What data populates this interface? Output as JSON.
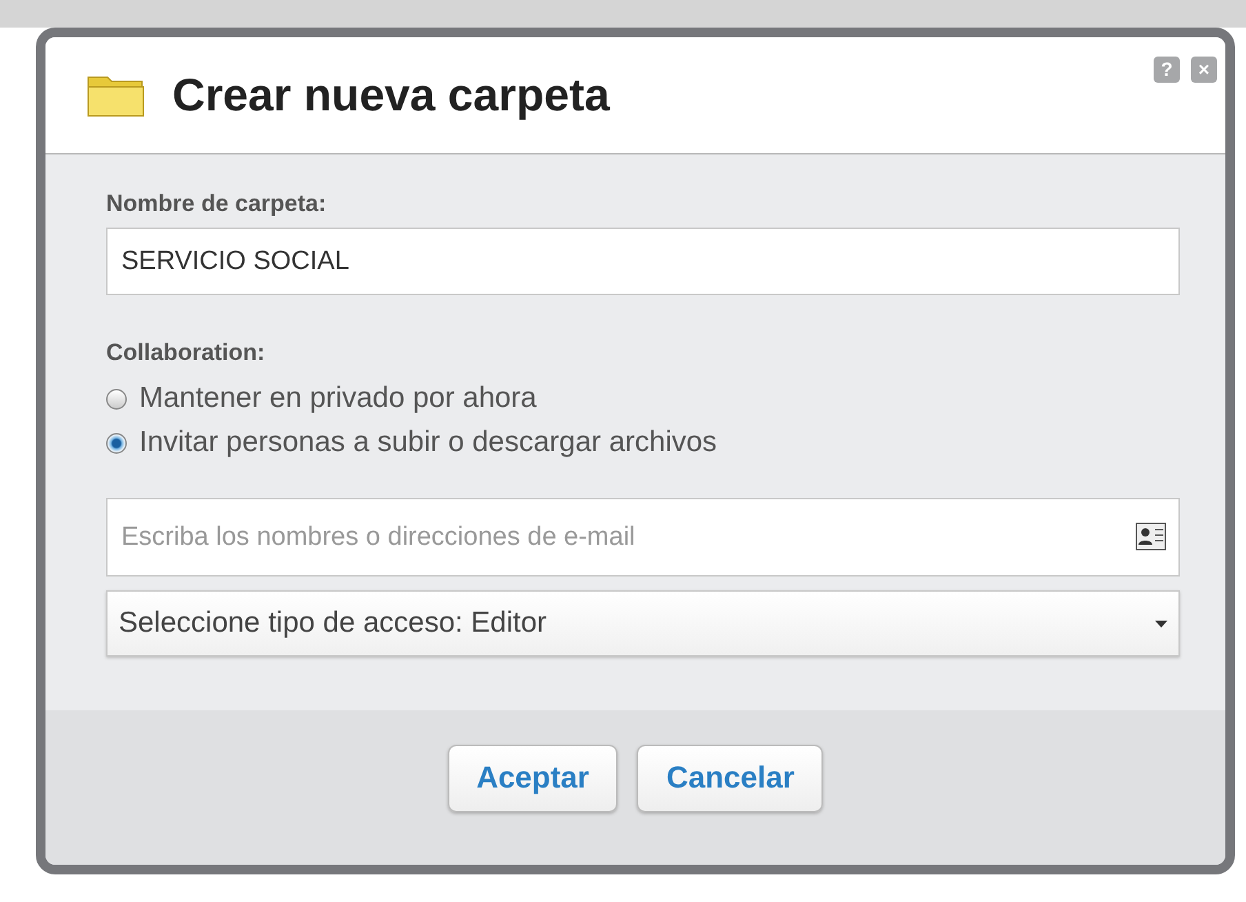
{
  "dialog": {
    "title": "Crear nueva carpeta",
    "help_button": "?",
    "close_button": "×"
  },
  "folder_name": {
    "label": "Nombre de carpeta:",
    "value": "SERVICIO SOCIAL"
  },
  "collaboration": {
    "label": "Collaboration:",
    "options": [
      {
        "label": "Mantener en privado por ahora",
        "selected": false
      },
      {
        "label": "Invitar personas a subir o descargar archivos",
        "selected": true
      }
    ]
  },
  "invite_field": {
    "placeholder": "Escriba los nombres o direcciones de e-mail"
  },
  "access_select": {
    "value": "Seleccione tipo de acceso: Editor"
  },
  "buttons": [
    "Aceptar",
    "Cancelar"
  ]
}
